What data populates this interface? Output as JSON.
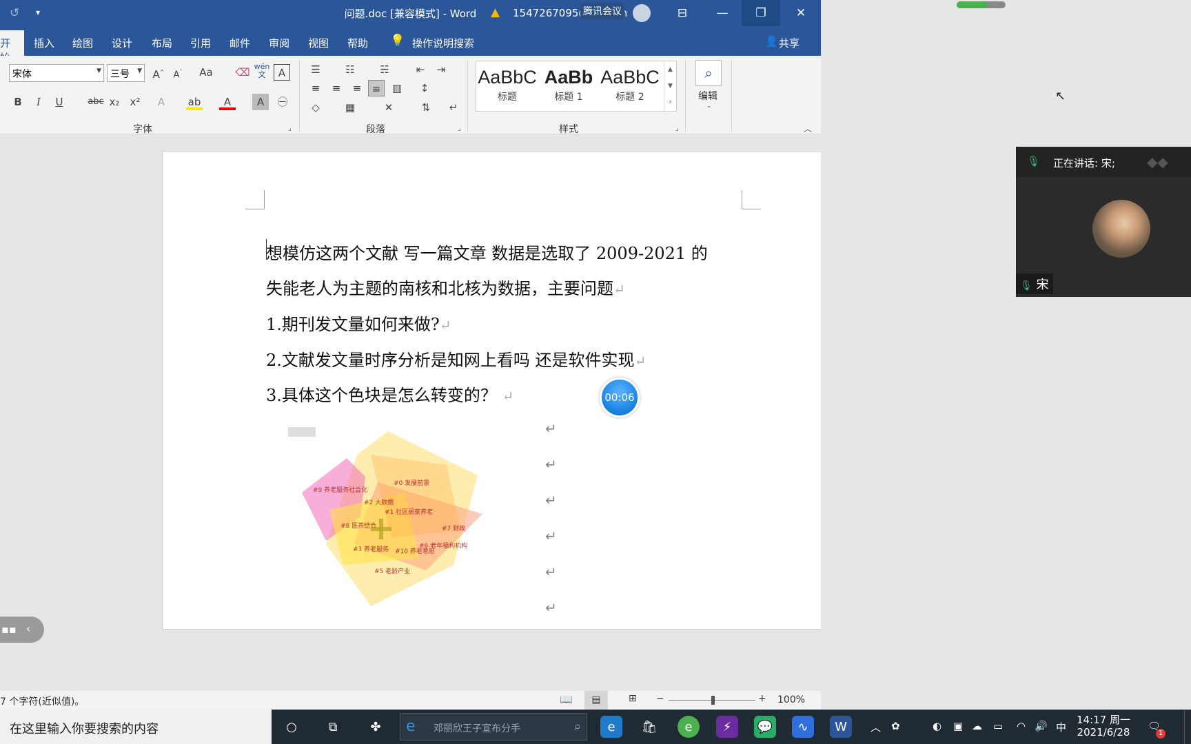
{
  "window": {
    "title": "问题.doc [兼容模式]  -  Word",
    "warning_account": "1547267095@qq.com",
    "meeting_app": "腾讯会议"
  },
  "tabs": [
    {
      "label": "开始",
      "active": true
    },
    {
      "label": "插入"
    },
    {
      "label": "绘图"
    },
    {
      "label": "设计"
    },
    {
      "label": "布局"
    },
    {
      "label": "引用"
    },
    {
      "label": "邮件"
    },
    {
      "label": "审阅"
    },
    {
      "label": "视图"
    },
    {
      "label": "帮助"
    }
  ],
  "tell_me": "操作说明搜索",
  "share": "共享",
  "ribbon": {
    "font_name": "宋体",
    "font_size": "三号",
    "groups": {
      "font": "字体",
      "paragraph": "段落",
      "styles": "样式",
      "edit": "编辑"
    },
    "styles": [
      {
        "sample": "AaBbC",
        "name": "标题"
      },
      {
        "sample": "AaBb",
        "name": "标题 1"
      },
      {
        "sample": "AaBbC",
        "name": "标题 2"
      }
    ],
    "icons": {
      "bold": "B",
      "italic": "I",
      "underline": "U",
      "strike": "abc",
      "subscript": "x₂",
      "superscript": "x²",
      "grow": "A",
      "shrink": "A",
      "case": "Aa",
      "phonetic": "wén 文"
    }
  },
  "document": {
    "lines": [
      {
        "text": "想模仿这两个文献  写一篇文章  数据是选取了 2009-2021 的",
        "mark": false
      },
      {
        "text": "失能老人为主题的南核和北核为数据，主要问题",
        "mark": true
      },
      {
        "text": "1.期刊发文量如何来做?",
        "mark": true
      },
      {
        "text": "2.文献发文量时序分析是知网上看吗  还是软件实现",
        "mark": true
      },
      {
        "text": "3.具体这个色块是怎么转变的？",
        "mark": true
      }
    ],
    "para_mark": "↵",
    "cluster_labels": [
      "#0 发展前景",
      "#9 养老服务社会化",
      "#2 大数据",
      "#1 社区居家养老",
      "#8 医养结合",
      "#7 财政",
      "#6 老年福利机构",
      "#3 养老服务",
      "#10 养老意愿",
      "#5 老龄产业"
    ]
  },
  "timer": "00:06",
  "status": {
    "word_count": "7 个字符(近似值)。",
    "zoom": "100%",
    "zoom_level": 1.0
  },
  "meeting": {
    "speaking": "正在讲话: 宋;",
    "participant": "宋"
  },
  "taskbar": {
    "search_placeholder": "在这里输入你要搜索的内容",
    "browser_search": "邓丽欣王子宣布分手",
    "time": "14:17 周一",
    "date": "2021/6/28",
    "ime": "中",
    "notification_count": "1"
  },
  "colors": {
    "word_blue": "#2b579a",
    "taskbar": "#1f2a33"
  }
}
